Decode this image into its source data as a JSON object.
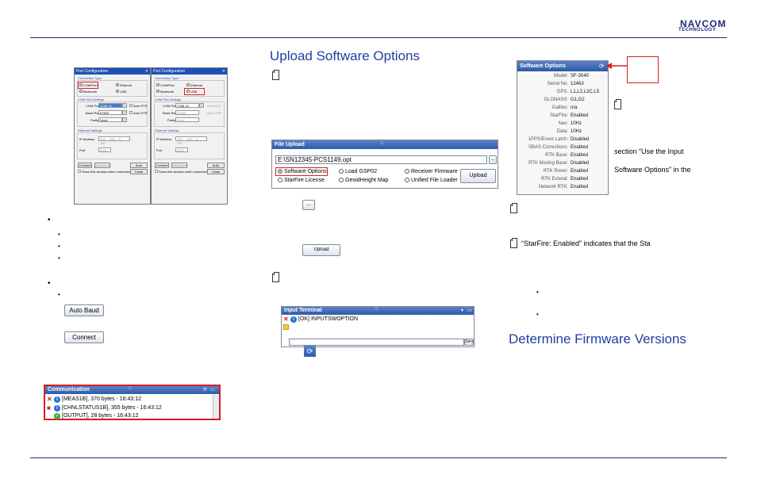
{
  "header": {
    "logo_line1": "NAVCOM",
    "logo_line2": "TECHNOLOGY"
  },
  "left": {
    "port_config_1": {
      "title": "Port Configuration",
      "connection_type": "Connection Type",
      "com_port": "COM/Port",
      "ethernet": "Ethernet",
      "bluetooth": "Bluetooth",
      "usb": "USB",
      "com_settings": "COM Port Settings",
      "com_port_label": "COM Port",
      "com_port_value": "COM 10",
      "baud_label": "Baud Rate",
      "baud_value": "57600",
      "parity_label": "Parity",
      "parity_value": "None",
      "auto_rts": "Auto RTS",
      "auto_dtr": "Auto DTR",
      "ethernet_settings": "Ethernet Settings",
      "ip_label": "IP Address",
      "ip_values": [
        "192",
        "168",
        "0",
        "100"
      ],
      "port_label": "Port",
      "port_value": "4001",
      "connect": "Connect",
      "disconnect": "Disconnect",
      "autodetect": "Auto Detect",
      "show_dialog": "Show this window when connected",
      "close": "Close"
    },
    "port_config_2": {
      "title": "Port Configuration",
      "connection_type": "Connection Type",
      "com_port": "COM/Port",
      "ethernet": "Ethernet",
      "bluetooth": "Bluetooth",
      "usb": "USB",
      "com_settings": "COM Port Settings",
      "com_port_label": "COM Port",
      "com_port_value": "COM 10",
      "baud_label": "Baud Rate",
      "baud_value": "57600",
      "parity_label": "Parity",
      "parity_value": "None",
      "auto_rts": "Auto RTS",
      "auto_dtr": "Auto DTR",
      "ethernet_settings": "Ethernet Settings",
      "ip_label": "IP Address",
      "ip_values": [
        "192",
        "168",
        "0",
        "100"
      ],
      "port_label": "Port",
      "port_value": "4001",
      "connect": "Connect",
      "disconnect": "Disconnect",
      "autodetect": "Auto Detect",
      "show_dialog": "Show this window when connected",
      "close": "Close"
    },
    "auto_baud_button": "Auto Baud",
    "connect_button": "Connect",
    "communication": {
      "title": "Communication",
      "rows": [
        "[MEAS1B], 370 bytes - 16:43:12",
        "[CHNLSTATUS1B], 355 bytes - 16:43:12",
        "[OUTPUT], 28 bytes - 16:43:12"
      ]
    }
  },
  "middle": {
    "heading": "Upload Software Options",
    "file_upload": {
      "title": "File Upload",
      "path": "E:\\SN12345-PCS1149.opt",
      "browse_label": "...",
      "options": [
        "Software Options",
        "Load GSP02",
        "Receiver Firmware",
        "StarFire License",
        "GeoidHeight Map",
        "Unified File Loader"
      ],
      "upload": "Upload"
    },
    "browse_small": "...",
    "upload_small": "Upload",
    "input_terminal": {
      "title": "Input Terminal",
      "line": "[OK] INPUTSWOPTION",
      "send": "Send"
    }
  },
  "right": {
    "software_options": {
      "title": "Software Options",
      "rows": [
        {
          "label": "Model:",
          "value": "SF-3040"
        },
        {
          "label": "Serial No:",
          "value": "12463"
        },
        {
          "label": "GPS:",
          "value": "L1,L2,L2C,L5"
        },
        {
          "label": "GLONASS:",
          "value": "G1,G2"
        },
        {
          "label": "Galileo:",
          "value": "n/a"
        },
        {
          "label": "StarFire:",
          "value": "Enabled"
        },
        {
          "label": "Nav:",
          "value": "10Hz"
        },
        {
          "label": "Data:",
          "value": "10Hz"
        },
        {
          "label": "1PPS/Event Latch:",
          "value": "Disabled"
        },
        {
          "label": "SBAS Corrections:",
          "value": "Enabled"
        },
        {
          "label": "RTK Base:",
          "value": "Enabled"
        },
        {
          "label": "RTK Moving Base:",
          "value": "Disabled"
        },
        {
          "label": "RTK Rover:",
          "value": "Enabled"
        },
        {
          "label": "RTK Extend:",
          "value": "Enabled"
        },
        {
          "label": "Network RTK:",
          "value": "Enabled"
        }
      ]
    },
    "text_section_use": "section “Use the Input",
    "text_software_options": "Software Options” in the",
    "text_starfire": "“StarFire: Enabled” indicates that the Sta",
    "heading_firmware": "Determine Firmware Versions"
  }
}
